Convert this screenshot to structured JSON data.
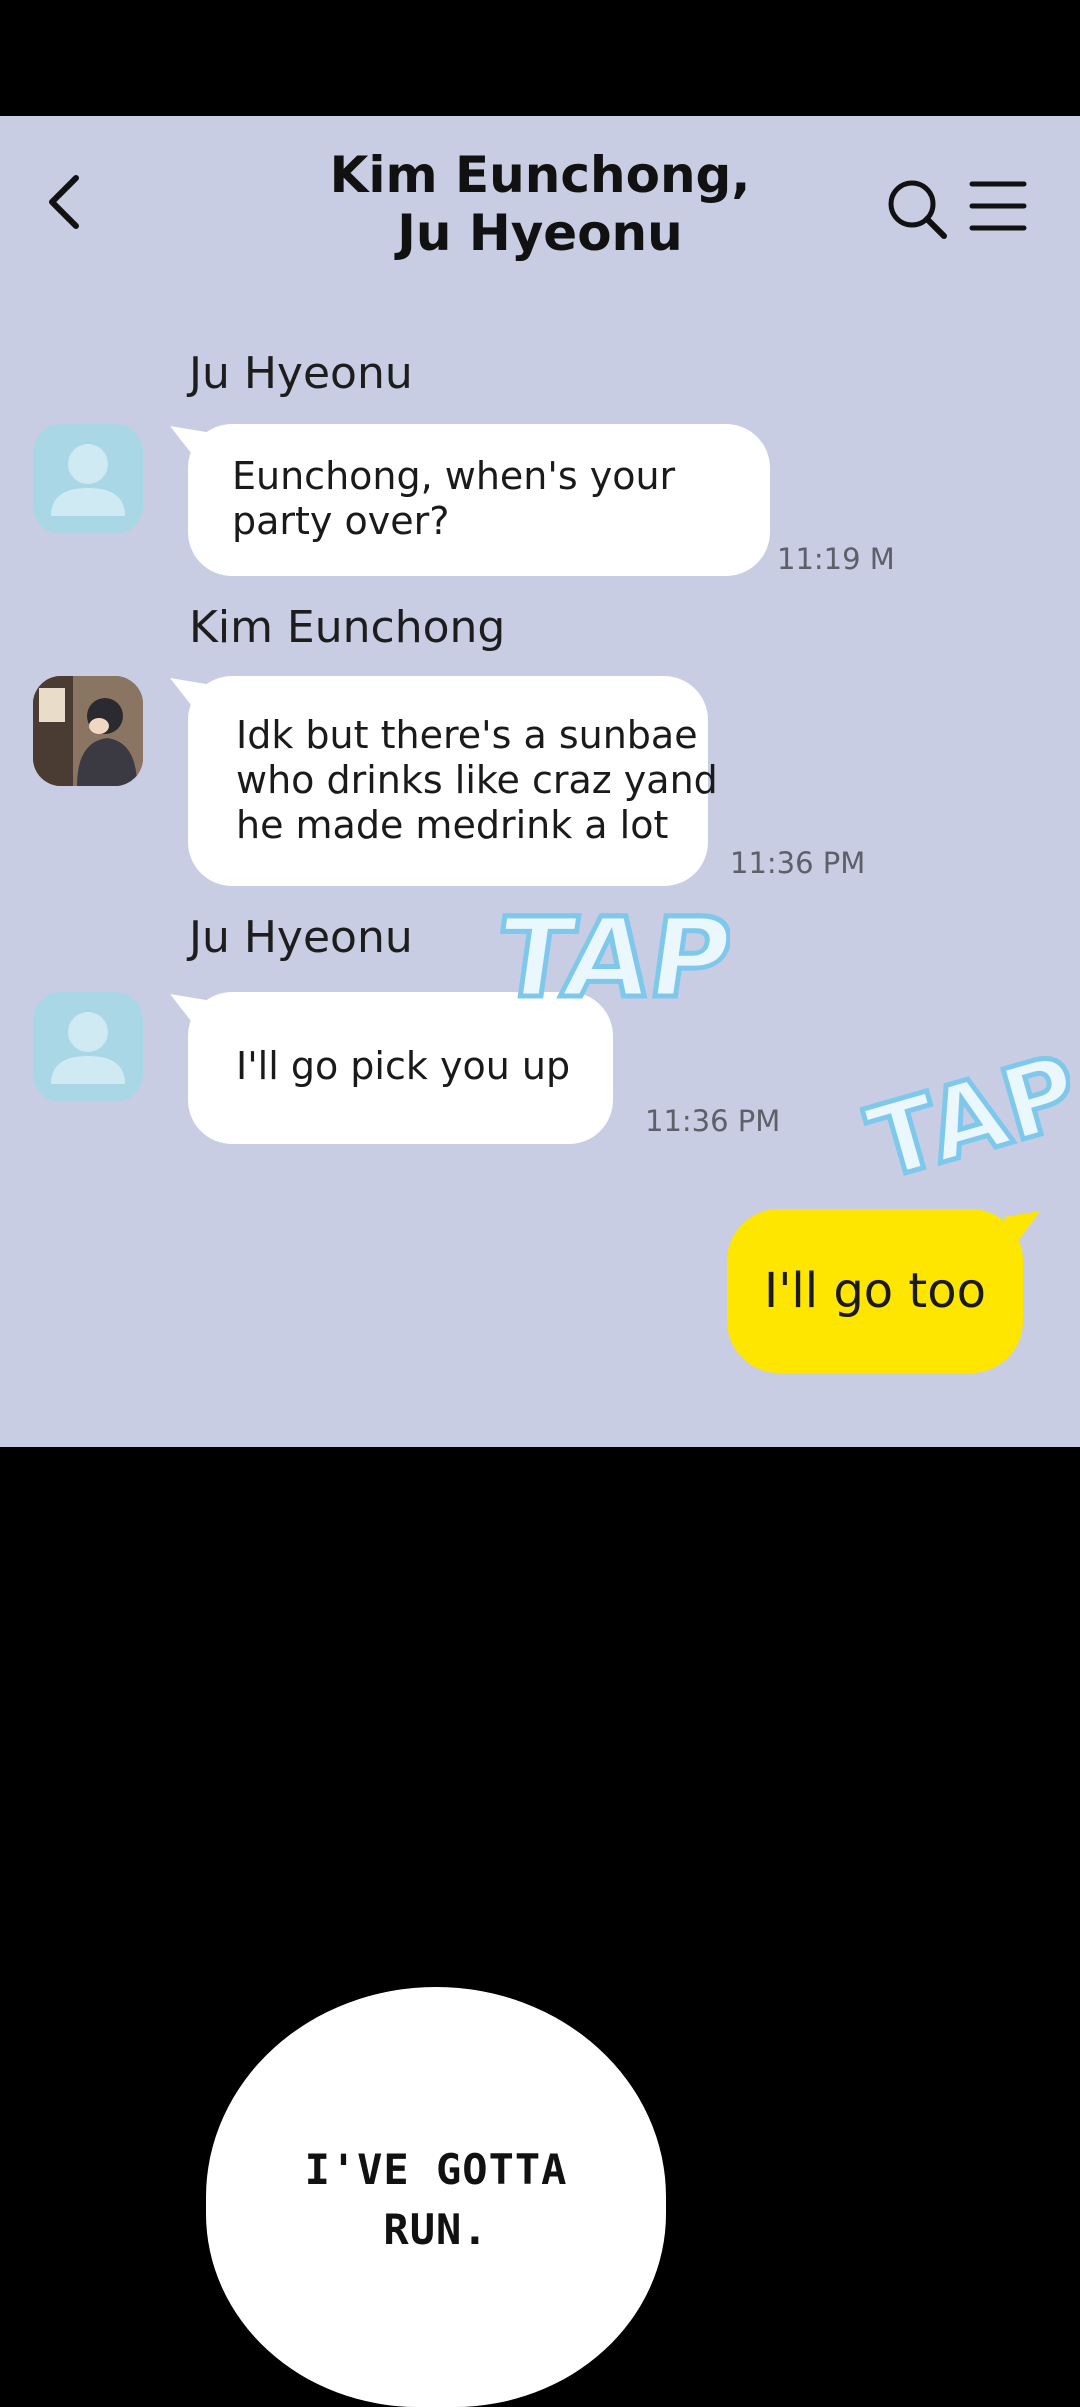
{
  "chat": {
    "title_line1": "Kim Eunchong,",
    "title_line2": "Ju Hyeonu",
    "messages": [
      {
        "sender": "Ju Hyeonu",
        "lines": [
          "Eunchong, when's your",
          "party over?"
        ],
        "time": "11:19 M"
      },
      {
        "sender": "Kim Eunchong",
        "lines": [
          "Idk but there's a sunbae",
          "who drinks like craz yand",
          "he made medrink a lot"
        ],
        "time": "11:36 PM"
      },
      {
        "sender": "Ju Hyeonu",
        "lines": [
          "I'll go pick you up"
        ],
        "time": "11:36 PM"
      }
    ],
    "my_message": "I'll go too"
  },
  "sfx": {
    "tap1": "TAP",
    "tap2": "TAP"
  },
  "speech": {
    "line1": "I'VE GOTTA",
    "line2": "RUN."
  },
  "icons": {
    "back": "chevron-left-icon",
    "search": "search-icon",
    "menu": "hamburger-menu-icon",
    "avatar": "default-user-icon"
  },
  "colors": {
    "panel_bg": "#c8cde3",
    "my_bubble": "#ffe600",
    "avatar_default": "#a9d7e6"
  }
}
